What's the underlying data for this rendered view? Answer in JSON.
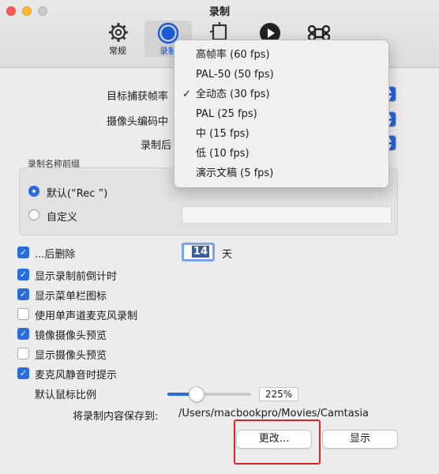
{
  "window": {
    "title": "录制"
  },
  "toolbar": {
    "items": [
      {
        "label": "常规",
        "icon": "gear-icon"
      },
      {
        "label": "录制",
        "icon": "record-icon",
        "selected": true
      },
      {
        "label": "",
        "icon": "extension-icon"
      },
      {
        "label": "",
        "icon": "play-icon"
      },
      {
        "label": "",
        "icon": "command-icon"
      }
    ]
  },
  "form": {
    "frame_rate_label": "目标捕获帧率",
    "camera_codec_label": "摄像头编码中",
    "after_record_label": "录制后"
  },
  "name_prefix": {
    "title": "录制名称前缀",
    "default_label": "默认(“Rec ”)",
    "custom_label": "自定义",
    "selected": "default"
  },
  "checkboxes": [
    {
      "label": "...后删除",
      "checked": true
    },
    {
      "label": "显示录制前倒计时",
      "checked": true
    },
    {
      "label": "显示菜单栏图标",
      "checked": true
    },
    {
      "label": "使用单声道麦克风录制",
      "checked": false
    },
    {
      "label": "镜像摄像头预览",
      "checked": true
    },
    {
      "label": "显示摄像头预览",
      "checked": false
    },
    {
      "label": "麦克风静音时提示",
      "checked": true
    }
  ],
  "delete_after": {
    "value": "14",
    "unit": "天"
  },
  "cursor_scale": {
    "label": "默认鼠标比例",
    "value": "225%",
    "slider_fraction": 0.35
  },
  "save_location": {
    "label": "将录制内容保存到:",
    "path": "/Users/macbookpro/Movies/Camtasia"
  },
  "buttons": {
    "change": "更改...",
    "show": "显示"
  },
  "frame_rate_menu": {
    "options": [
      {
        "label": "高帧率 (60 fps)",
        "checked": false
      },
      {
        "label": "PAL-50 (50 fps)",
        "checked": false
      },
      {
        "label": "全动态 (30 fps)",
        "checked": true
      },
      {
        "label": "PAL (25 fps)",
        "checked": false
      },
      {
        "label": "中 (15 fps)",
        "checked": false
      },
      {
        "label": "低 (10 fps)",
        "checked": false
      },
      {
        "label": "演示文稿 (5 fps)",
        "checked": false
      }
    ]
  },
  "colors": {
    "accent": "#2b6be0",
    "highlight": "#d6262a"
  }
}
